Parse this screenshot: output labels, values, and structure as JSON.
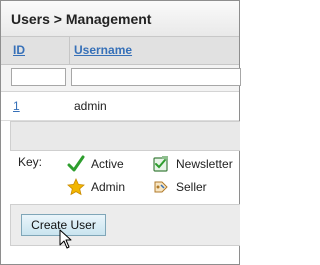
{
  "panel": {
    "title": "Users > Management"
  },
  "grid": {
    "columns": [
      {
        "label": "ID"
      },
      {
        "label": "Username"
      }
    ],
    "filters": {
      "id_value": "",
      "username_value": ""
    },
    "rows": [
      {
        "id": "1",
        "username": "admin"
      }
    ]
  },
  "key": {
    "label": "Key:",
    "items": [
      {
        "icon": "check-icon",
        "label": "Active"
      },
      {
        "icon": "newsletter-icon",
        "label": "Newsletter"
      },
      {
        "icon": "star-icon",
        "label": "Admin"
      },
      {
        "icon": "seller-icon",
        "label": "Seller"
      }
    ]
  },
  "actions": {
    "create_user_label": "Create User"
  },
  "colors": {
    "link": "#3670b8",
    "button_fill": "#c9e4ef",
    "check": "#2e9e2e",
    "star": "#f2b600"
  }
}
